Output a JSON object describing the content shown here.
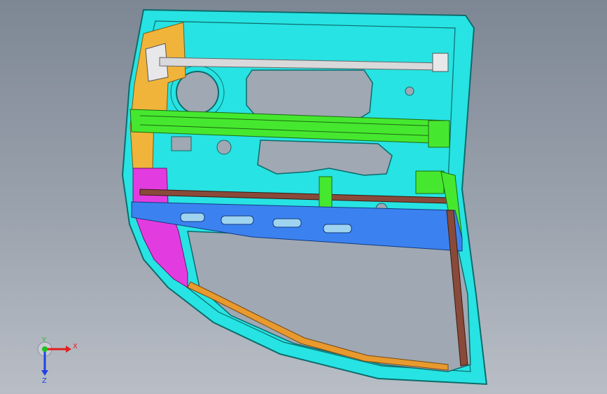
{
  "viewport": {
    "background_top": "#7d8794",
    "background_bottom": "#b9bec6"
  },
  "model": {
    "part_colors": {
      "door_shell": "#27e3e3",
      "shell_edge": "#0d6b6b",
      "hinge_reinforcement": "#f0b43a",
      "lock_bracket": "#e23ce0",
      "upper_rail": "#46e82f",
      "impact_beam": "#8a4a3a",
      "belt_beam": "#3b82f0",
      "window_channel": "#e89a2e",
      "support_rod": "#d9d9dc"
    }
  },
  "triad": {
    "x_label": "X",
    "y_label": "Y",
    "z_label": "Z",
    "x_color": "#e02020",
    "y_color": "#20c020",
    "z_color": "#2040e0"
  }
}
